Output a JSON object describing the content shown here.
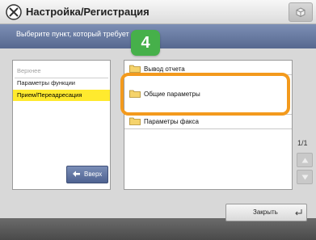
{
  "header": {
    "title": "Настройка/Регистрация",
    "settings_icon": "wrench-screwdriver-icon",
    "corner_button_icon": "cube-icon"
  },
  "instruction": {
    "text": "Выберите пункт, который требует",
    "step_number": "4"
  },
  "left_panel": {
    "items": [
      {
        "label": "Верхнее",
        "state": "dim"
      },
      {
        "label": "Параметры функции",
        "state": "normal"
      },
      {
        "label": "Прием/Переадресация",
        "state": "selected"
      }
    ],
    "up_button_label": "Вверх",
    "up_button_icon": "arrow-up-icon"
  },
  "right_panel": {
    "items": [
      {
        "label": "Вывод отчета",
        "icon": "folder-icon"
      },
      {
        "label": "Общие параметры",
        "icon": "folder-icon",
        "highlighted": true
      },
      {
        "label": "Параметры факса",
        "icon": "folder-icon"
      }
    ]
  },
  "pagination": {
    "page": "1/1"
  },
  "footer": {
    "close_label": "Закрыть"
  },
  "colors": {
    "accent_blue": "#56688f",
    "selection_yellow": "#ffea2e",
    "highlight_orange": "#f39a1d",
    "step_green": "#46b04a"
  }
}
